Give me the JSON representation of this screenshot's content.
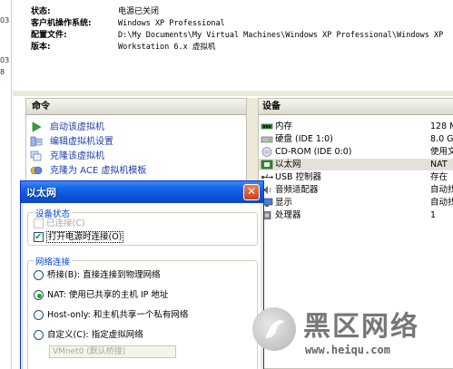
{
  "gutter": [
    "03",
    "03",
    "8"
  ],
  "summary": {
    "rows": [
      {
        "label": "状态:",
        "value": "电源已关闭"
      },
      {
        "label": "客户机操作系统:",
        "value": "Windows XP Professional"
      },
      {
        "label": "配置文件:",
        "value": "D:\\My Documents\\My Virtual Machines\\Windows XP Professional\\Windows XP"
      },
      {
        "label": "版本:",
        "value": "Workstation 6.x 虚拟机"
      }
    ]
  },
  "commands": {
    "header": "命令",
    "items": [
      {
        "label": "启动该虚拟机",
        "icon": "play-icon"
      },
      {
        "label": "编辑虚拟机设置",
        "icon": "settings-icon"
      },
      {
        "label": "克隆该虚拟机",
        "icon": "clone-icon"
      },
      {
        "label": "克隆为 ACE 虚拟机模板",
        "icon": "ace-template-icon"
      }
    ]
  },
  "devices": {
    "header": "设备",
    "rows": [
      {
        "name": "内存",
        "summary": "128 M",
        "icon": "memory-icon"
      },
      {
        "name": "硬盘 (IDE 1:0)",
        "summary": "8.0 G",
        "icon": "harddisk-icon"
      },
      {
        "name": "CD-ROM (IDE 0:0)",
        "summary": "使用文",
        "icon": "cdrom-icon"
      },
      {
        "name": "以太网",
        "summary": "NAT",
        "icon": "ethernet-icon",
        "selected": true
      },
      {
        "name": "USB 控制器",
        "summary": "存在",
        "icon": "usb-icon"
      },
      {
        "name": "音频适配器",
        "summary": "自动找",
        "icon": "audio-icon"
      },
      {
        "name": "显示",
        "summary": "自动找",
        "icon": "display-icon"
      },
      {
        "name": "处理器",
        "summary": "1",
        "icon": "cpu-icon"
      }
    ]
  },
  "dialog": {
    "title": "以太网",
    "device_status": {
      "legend": "设备状态",
      "connected_label": "已连接(C)",
      "connect_at_power_on_label": "打开电源时连接(O)"
    },
    "network": {
      "legend": "网络连接",
      "options": [
        {
          "label": "桥接(B): 直接连接到物理网络",
          "selected": false
        },
        {
          "label": "NAT: 使用已共享的主机 IP 地址",
          "selected": true
        },
        {
          "label": "Host-only: 和主机共享一个私有网络",
          "selected": false
        },
        {
          "label": "自定义(C): 指定虚拟网络",
          "selected": false
        }
      ],
      "custom_network_value": "VMnet0 (默认桥接)"
    }
  },
  "watermark": {
    "text": "黑区网络",
    "url": "www.heiqu.com"
  },
  "colors": {
    "link": "#1c3ea8",
    "titlebar": "#0a52d8",
    "legend": "#0046d5",
    "check": "#21a121"
  }
}
